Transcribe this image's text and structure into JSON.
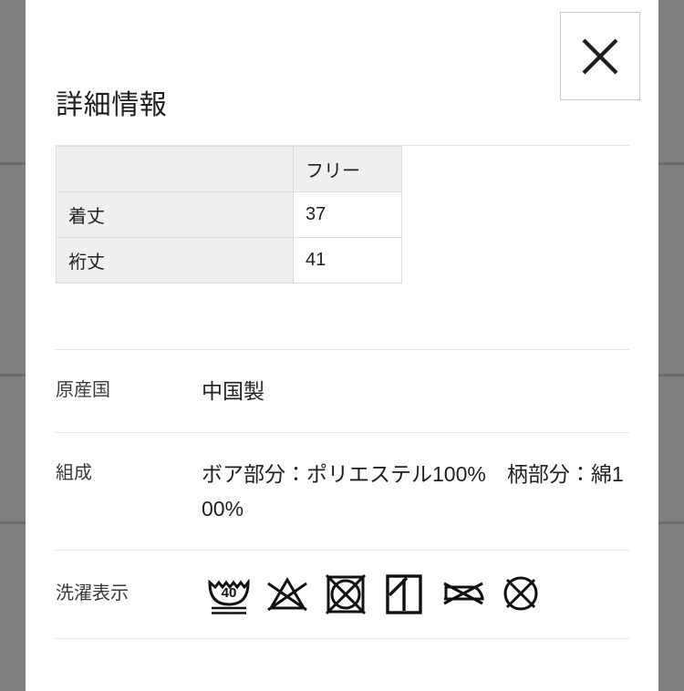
{
  "modal": {
    "title": "詳細情報",
    "close_button_label": "閉じる",
    "close_icon": "close-x-icon"
  },
  "size_table": {
    "columns": [
      "",
      "フリー"
    ],
    "rows": [
      {
        "label": "着丈",
        "value": "37"
      },
      {
        "label": "裄丈",
        "value": "41"
      }
    ]
  },
  "details": [
    {
      "label": "原産国",
      "value": "中国製"
    },
    {
      "label": "組成",
      "value": "ボア部分：ポリエステル100%　柄部分：綿100%"
    }
  ],
  "care": {
    "label": "洗濯表示",
    "symbols": [
      {
        "name": "wash-40-very-gentle-icon",
        "text": "40"
      },
      {
        "name": "do-not-bleach-icon",
        "text": ""
      },
      {
        "name": "do-not-tumble-dry-icon",
        "text": ""
      },
      {
        "name": "line-dry-in-shade-icon",
        "text": ""
      },
      {
        "name": "do-not-iron-icon",
        "text": ""
      },
      {
        "name": "do-not-dry-clean-icon",
        "text": ""
      }
    ]
  },
  "backdrop": {
    "color": "#808080",
    "rule_color": "#6b6b6b",
    "rule_positions": [
      178,
      410,
      572
    ]
  }
}
